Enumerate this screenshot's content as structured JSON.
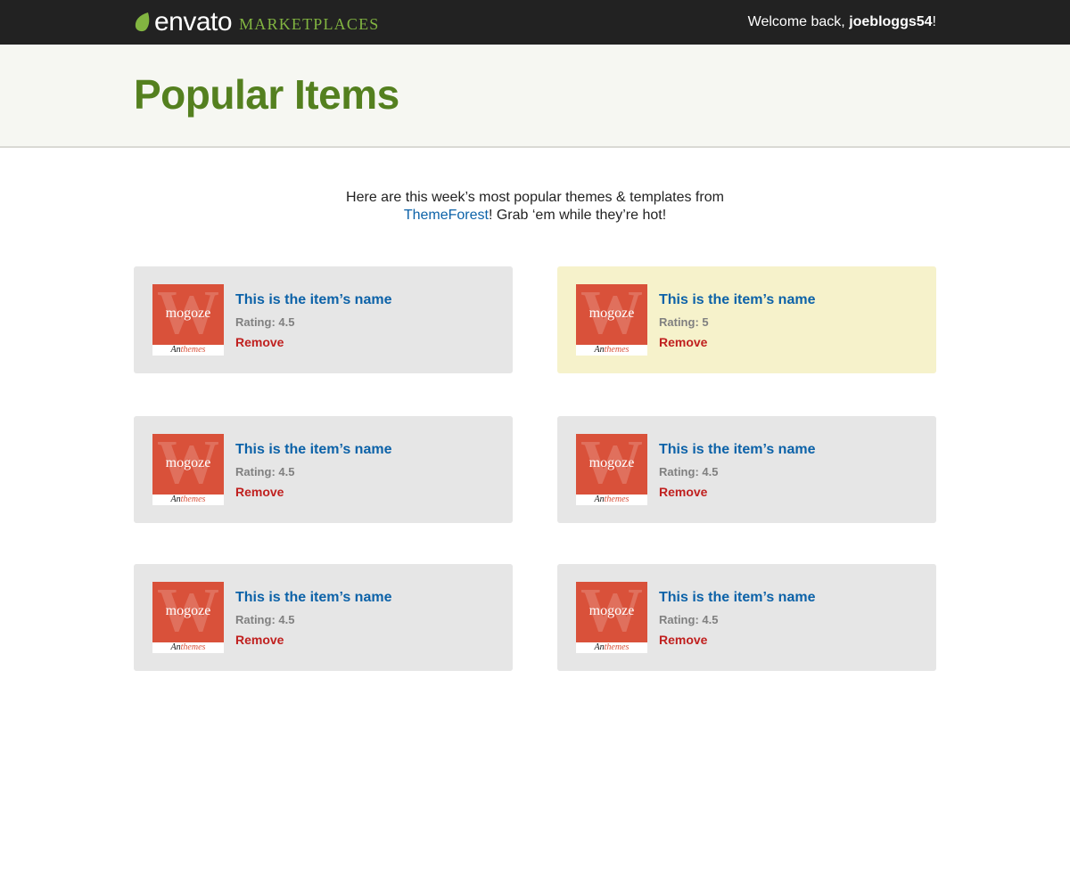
{
  "header": {
    "logo_word": "envato",
    "logo_sub": "MARKETPLACES",
    "welcome_prefix": "Welcome back, ",
    "username": "joebloggs54",
    "welcome_suffix": "!"
  },
  "hero": {
    "title": "Popular Items"
  },
  "intro": {
    "line1": "Here are this week’s most popular themes & templates from",
    "link": "ThemeForest",
    "line2_rest": "! Grab ‘em while they’re hot!"
  },
  "thumbnail": {
    "name": "mogoze",
    "foot_a": "An",
    "foot_b": "themes"
  },
  "items": [
    {
      "name": "This is the item’s name",
      "rating": "Rating: 4.5",
      "remove": "Remove",
      "highlighted": false
    },
    {
      "name": "This is the item’s name",
      "rating": "Rating: 5",
      "remove": "Remove",
      "highlighted": true
    },
    {
      "name": "This is the item’s name",
      "rating": "Rating: 4.5",
      "remove": "Remove",
      "highlighted": false
    },
    {
      "name": "This is the item’s name",
      "rating": "Rating: 4.5",
      "remove": "Remove",
      "highlighted": false
    },
    {
      "name": "This is the item’s name",
      "rating": "Rating: 4.5",
      "remove": "Remove",
      "highlighted": false
    },
    {
      "name": "This is the item’s name",
      "rating": "Rating: 4.5",
      "remove": "Remove",
      "highlighted": false
    }
  ],
  "colors": {
    "topbar": "#222222",
    "brand_green": "#82b541",
    "title_green": "#54801f",
    "link_blue": "#0c62a8",
    "remove_red": "#c0201f",
    "card_bg": "#e6e6e6",
    "card_highlight": "#f6f2cb"
  }
}
